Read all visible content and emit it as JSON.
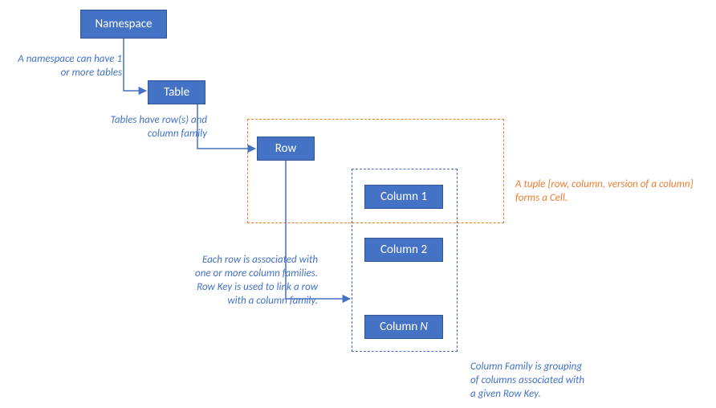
{
  "nodes": {
    "namespace": "Namespace",
    "table": "Table",
    "row": "Row",
    "column1": "Column 1",
    "column2": "Column 2",
    "columnN": "Column N"
  },
  "annotations": {
    "namespace_note": "A namespace can have 1\nor more tables",
    "table_note": "Tables have row(s) and\ncolumn family",
    "row_note": "Each row is associated with\none or more column families.\nRow Key is used to link a row\nwith a column family.",
    "cell_note": "A tuple {row, column, version of a column}\nforms a Cell.",
    "family_note": "Column Family is grouping\nof columns associated with\na given Row Key."
  }
}
